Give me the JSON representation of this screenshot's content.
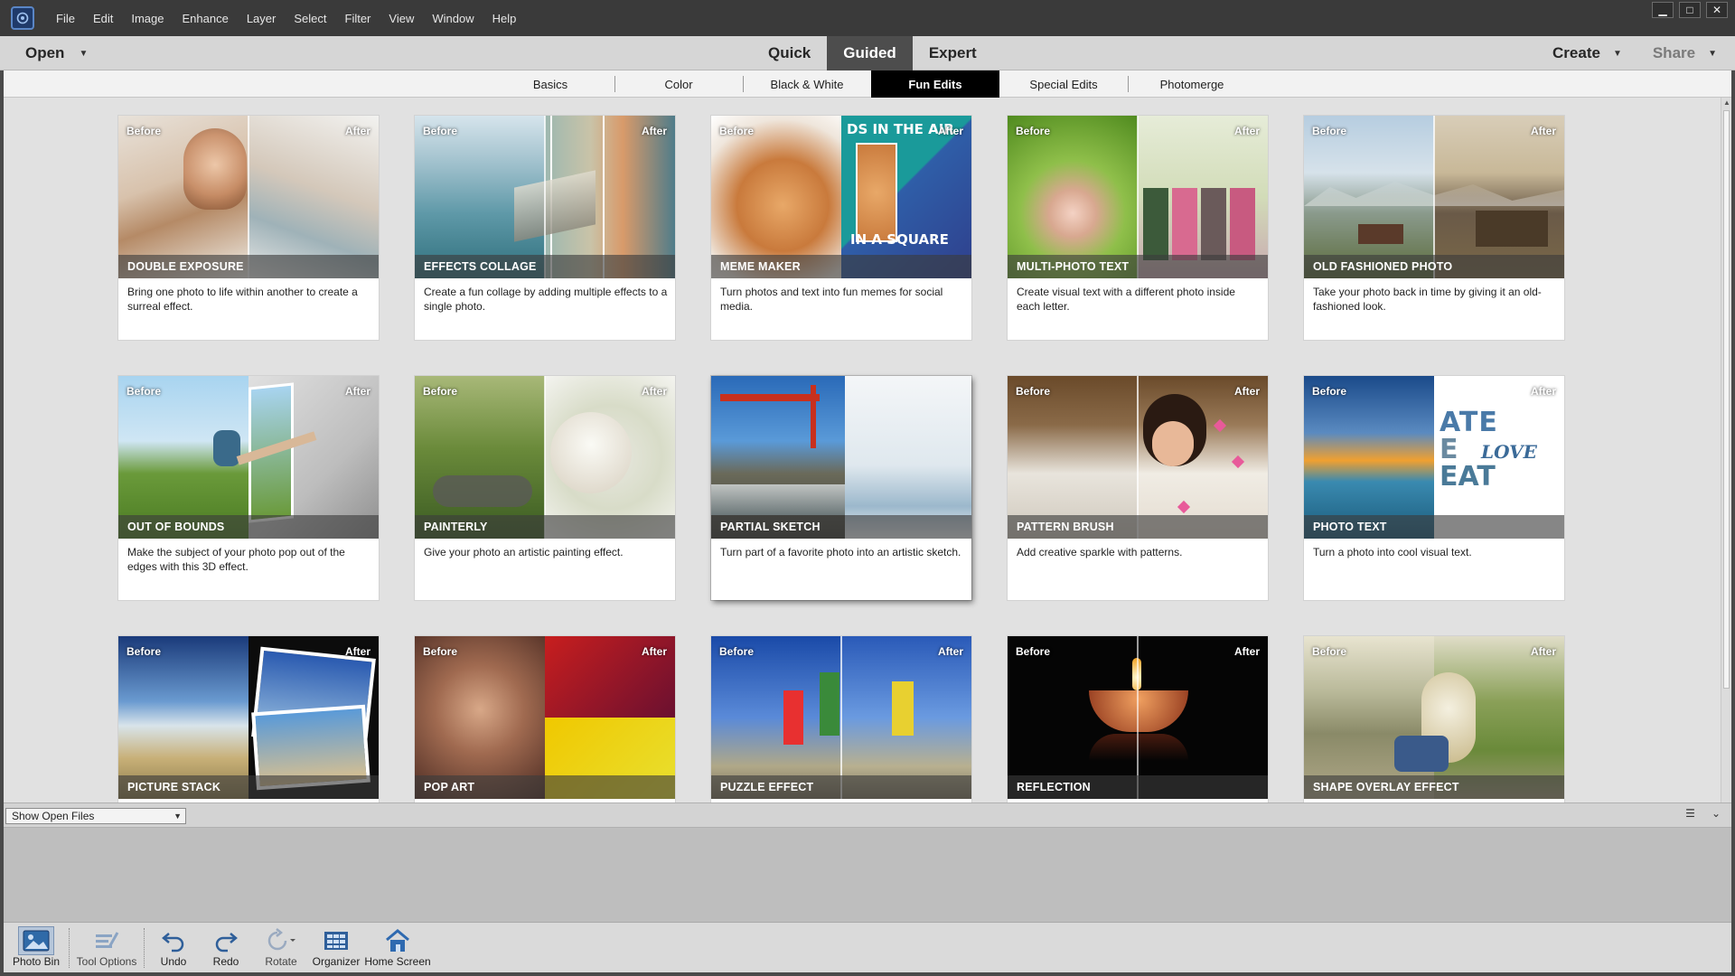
{
  "menu": [
    "File",
    "Edit",
    "Image",
    "Enhance",
    "Layer",
    "Select",
    "Filter",
    "View",
    "Window",
    "Help"
  ],
  "window_controls": {
    "minimize": "▁",
    "maximize": "□",
    "close": "✕"
  },
  "modebar": {
    "open_label": "Open",
    "modes": [
      "Quick",
      "Guided",
      "Expert"
    ],
    "active_mode": "Guided",
    "create_label": "Create",
    "share_label": "Share"
  },
  "subtabs": [
    "Basics",
    "Color",
    "Black & White",
    "Fun Edits",
    "Special Edits",
    "Photomerge"
  ],
  "active_subtab": "Fun Edits",
  "card_tags": {
    "before": "Before",
    "after": "After"
  },
  "cards": [
    {
      "title": "DOUBLE EXPOSURE",
      "desc": "Bring one photo to life within another to create a surreal effect."
    },
    {
      "title": "EFFECTS COLLAGE",
      "desc": "Create a fun collage by adding multiple effects to a single photo."
    },
    {
      "title": "MEME MAKER",
      "desc": "Turn photos and text into fun memes for social media.",
      "overlay_top": "DS IN THE AIR",
      "overlay_bottom": "IN A SQUARE"
    },
    {
      "title": "MULTI-PHOTO TEXT",
      "desc": "Create visual text with a different photo inside each letter."
    },
    {
      "title": "OLD FASHIONED PHOTO",
      "desc": "Take your photo back in time by giving it an old-fashioned look."
    },
    {
      "title": "OUT OF BOUNDS",
      "desc": "Make the subject of your photo pop out of the edges with this 3D effect."
    },
    {
      "title": "PAINTERLY",
      "desc": "Give your photo an artistic painting effect."
    },
    {
      "title": "PARTIAL SKETCH",
      "desc": "Turn part of a favorite photo into an artistic sketch."
    },
    {
      "title": "PATTERN BRUSH",
      "desc": "Add creative sparkle with patterns."
    },
    {
      "title": "PHOTO TEXT",
      "desc": "Turn a photo into cool visual text.",
      "overlay_1": "ATE",
      "overlay_2": "E",
      "overlay_3": "LOVE",
      "overlay_4": "EAT"
    },
    {
      "title": "PICTURE STACK",
      "desc": ""
    },
    {
      "title": "POP ART",
      "desc": ""
    },
    {
      "title": "PUZZLE EFFECT",
      "desc": ""
    },
    {
      "title": "REFLECTION",
      "desc": ""
    },
    {
      "title": "SHAPE OVERLAY EFFECT",
      "desc": ""
    }
  ],
  "binbar": {
    "select_value": "Show Open Files"
  },
  "toolbar": [
    "Photo Bin",
    "Tool Options",
    "Undo",
    "Redo",
    "Rotate",
    "Organizer",
    "Home Screen"
  ],
  "colors": {
    "accent_dark": "#4d4d4d",
    "active_subtab": "#000000",
    "titlebar": "#3a3a3a"
  }
}
